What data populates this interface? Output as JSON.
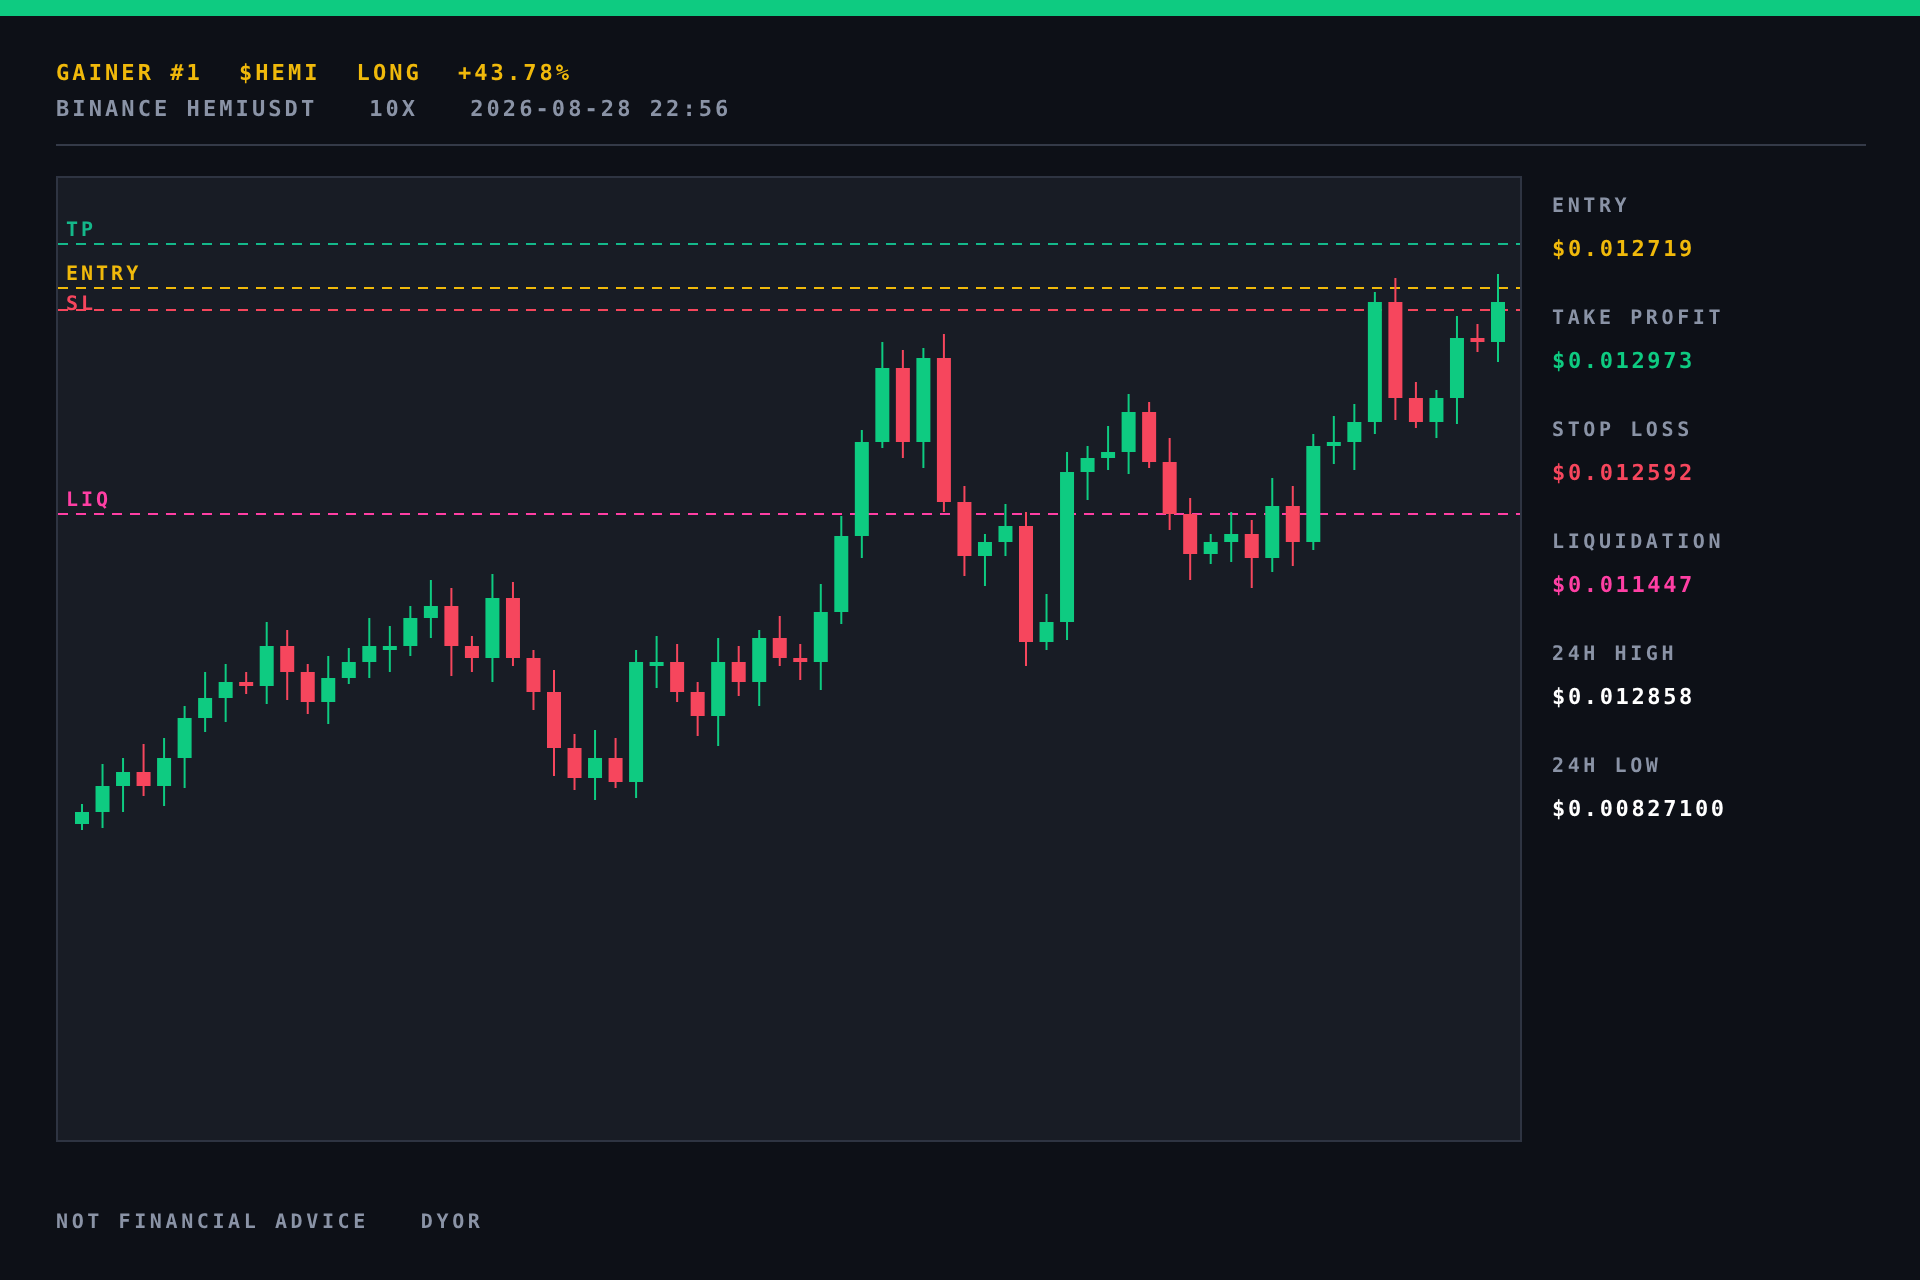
{
  "header": {
    "title_parts": [
      {
        "text": "GAINER #1"
      },
      {
        "text": "$HEMI"
      },
      {
        "text": "LONG"
      },
      {
        "text": "+43.78%"
      }
    ],
    "subtitle_parts": [
      {
        "text": "BINANCE HEMIUSDT"
      },
      {
        "text": "10X"
      },
      {
        "text": "2026-08-28 22:56"
      }
    ]
  },
  "chart": {
    "levels": [
      {
        "label": "TP",
        "color": "#14b88a"
      },
      {
        "label": "ENTRY",
        "color": "#f0b90b"
      },
      {
        "label": "SL",
        "color": "#f6465d"
      },
      {
        "label": "LIQ",
        "color": "#ff3fa4"
      }
    ]
  },
  "stats": [
    {
      "label": "ENTRY",
      "value": "$0.012719",
      "color": "#f0b90b"
    },
    {
      "label": "TAKE PROFIT",
      "value": "$0.012973",
      "color": "#0ecb81"
    },
    {
      "label": "STOP LOSS",
      "value": "$0.012592",
      "color": "#f6465d"
    },
    {
      "label": "LIQUIDATION",
      "value": "$0.011447",
      "color": "#ff3fa4"
    },
    {
      "label": "24H HIGH",
      "value": "$0.012858",
      "color": "#ffffff"
    },
    {
      "label": "24H LOW",
      "value": "$0.00827100",
      "color": "#ffffff"
    }
  ],
  "footer": [
    {
      "text": "NOT FINANCIAL ADVICE"
    },
    {
      "text": "DYOR"
    }
  ]
}
